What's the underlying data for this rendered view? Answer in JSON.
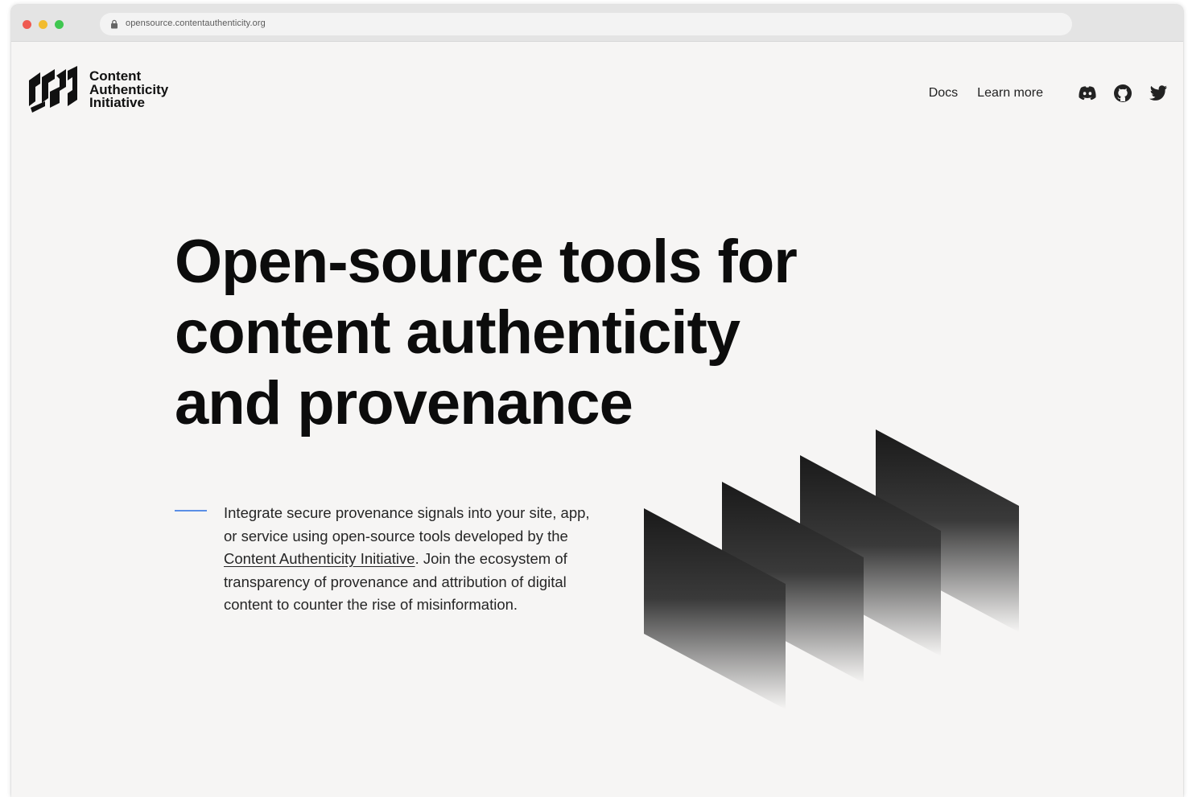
{
  "browser": {
    "url": "opensource.contentauthenticity.org"
  },
  "header": {
    "logo_lines": [
      "Content",
      "Authenticity",
      "Initiative"
    ],
    "nav": {
      "docs": "Docs",
      "learn_more": "Learn more"
    },
    "icons": [
      "discord-icon",
      "github-icon",
      "twitter-icon"
    ]
  },
  "hero": {
    "title_lines": [
      "Open-source tools for",
      "content authenticity",
      "and provenance"
    ],
    "body_before_link": "Integrate secure provenance signals into your site, app, or service using open-source tools developed by the ",
    "body_link": "Content Authenticity Initiative",
    "body_after_link": ". Join the ecosystem of transparency of provenance and attribution of digital content to counter the rise of misinformation."
  },
  "colors": {
    "page_background": "#f6f5f4",
    "accent_line": "#5b8fe6",
    "text": "#0c0c0c"
  }
}
